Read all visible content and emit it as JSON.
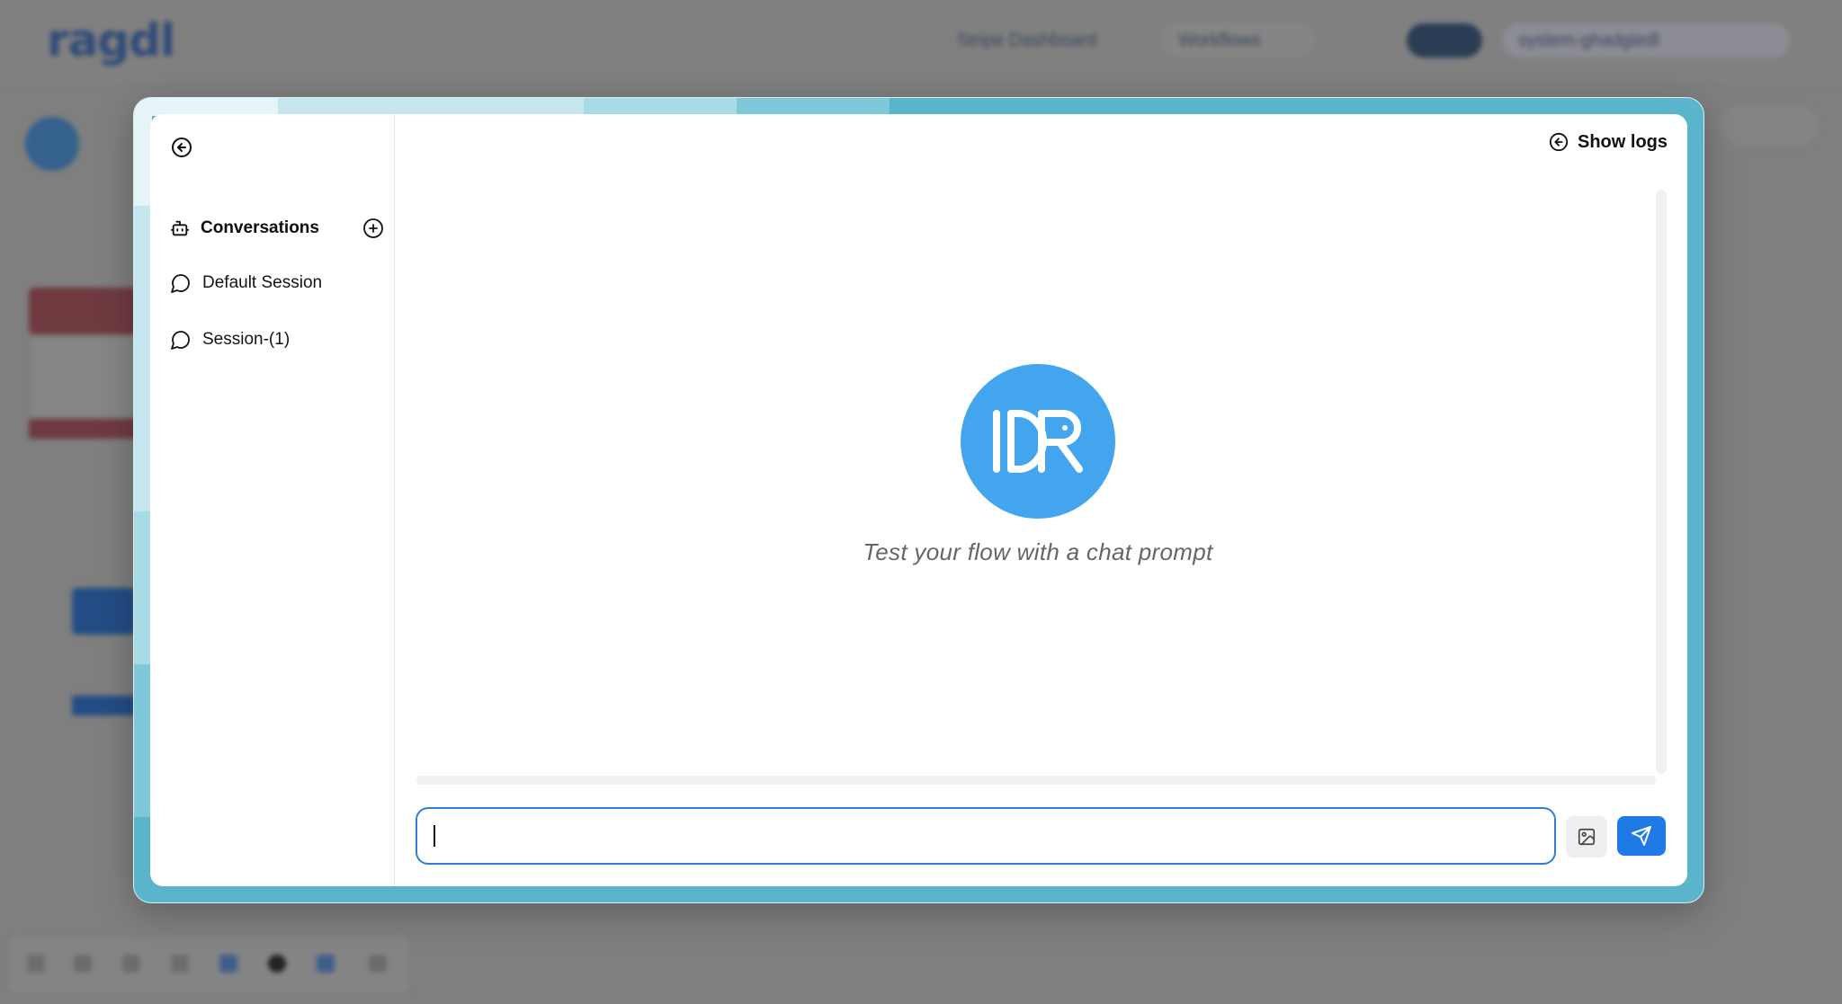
{
  "background": {
    "logo": "ragdl",
    "top_actions": [
      "Stripe Dashboard",
      "Workflows",
      "",
      "",
      "system-ghadgiedl"
    ]
  },
  "dialog": {
    "sidebar": {
      "conversations_label": "Conversations",
      "sessions": [
        {
          "label": "Default Session"
        },
        {
          "label": "Session-(1)"
        }
      ]
    },
    "header": {
      "show_logs_label": "Show logs"
    },
    "chat": {
      "empty_state_text": "Test your flow with a chat prompt",
      "input_value": "",
      "input_placeholder": ""
    },
    "colors": {
      "accent": "#1f7ae8",
      "avatar": "#42a5ee",
      "frame": "#5ab5cc"
    },
    "icons": {
      "back": "arrow-left-circle-icon",
      "conversations": "bot-icon",
      "add": "plus-circle-icon",
      "session": "message-circle-icon",
      "logs": "arrow-left-circle-icon",
      "image": "image-icon",
      "send": "send-icon"
    }
  }
}
